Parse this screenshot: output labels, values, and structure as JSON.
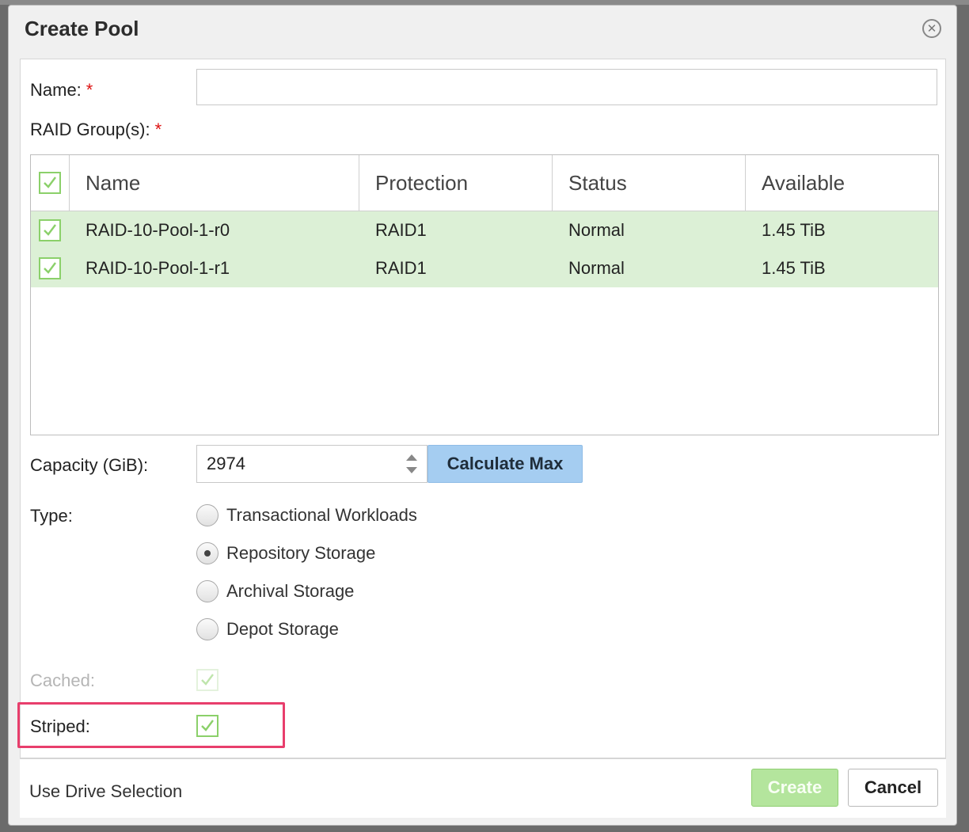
{
  "dialog": {
    "title": "Create Pool"
  },
  "form": {
    "name_label": "Name:",
    "required_mark": "*",
    "name_value": "",
    "raid_groups_label": "RAID Group(s):",
    "capacity_label": "Capacity (GiB):",
    "capacity_value": "2974",
    "calculate_max_label": "Calculate Max",
    "type_label": "Type:",
    "type_options": [
      {
        "label": "Transactional Workloads",
        "checked": false
      },
      {
        "label": "Repository Storage",
        "checked": true
      },
      {
        "label": "Archival Storage",
        "checked": false
      },
      {
        "label": "Depot Storage",
        "checked": false
      }
    ],
    "cached_label": "Cached:",
    "cached_checked": true,
    "cached_disabled": true,
    "striped_label": "Striped:",
    "striped_checked": true
  },
  "raid_table": {
    "columns": [
      "Name",
      "Protection",
      "Status",
      "Available"
    ],
    "rows": [
      {
        "name": "RAID-10-Pool-1-r0",
        "protection": "RAID1",
        "status": "Normal",
        "available": "1.45 TiB",
        "checked": true
      },
      {
        "name": "RAID-10-Pool-1-r1",
        "protection": "RAID1",
        "status": "Normal",
        "available": "1.45 TiB",
        "checked": true
      }
    ]
  },
  "footer": {
    "drive_selection_label": "Use Drive Selection",
    "create_label": "Create",
    "cancel_label": "Cancel"
  },
  "colors": {
    "check_green": "#8bd06a",
    "selected_row": "#dcf0d6",
    "calc_button": "#a5cdf1",
    "create_button_disabled": "#b4e59d",
    "highlight": "#e83e6c",
    "required": "#dd1111"
  }
}
